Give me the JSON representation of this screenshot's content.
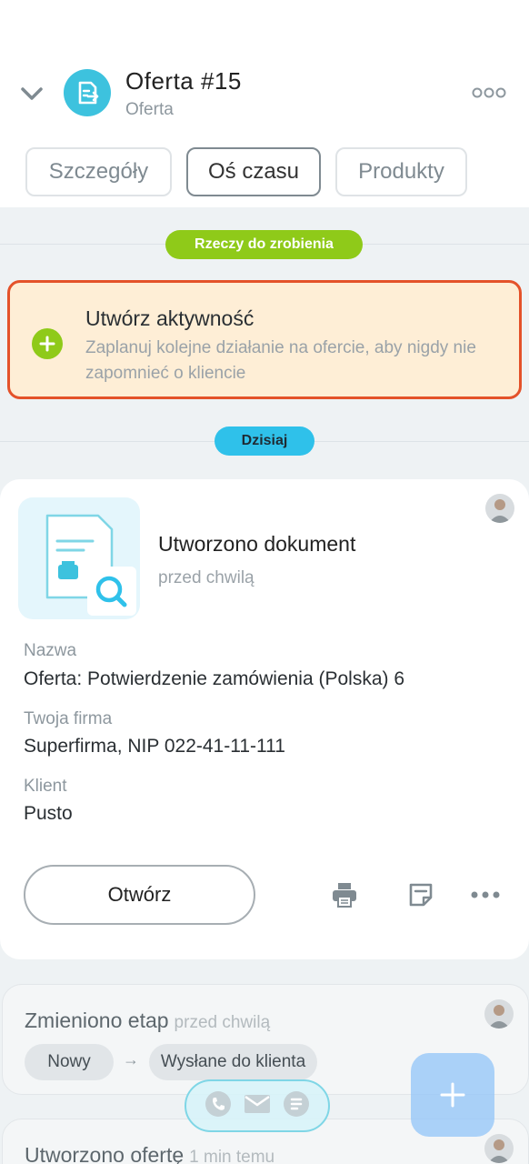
{
  "header": {
    "title": "Oferta #15",
    "subtitle": "Oferta"
  },
  "tabs": [
    {
      "label": "Szczegóły"
    },
    {
      "label": "Oś czasu"
    },
    {
      "label": "Produkty"
    }
  ],
  "todo_section": {
    "label": "Rzeczy do zrobienia",
    "color": "#8fca19",
    "card_title": "Utwórz aktywność",
    "card_desc": "Zaplanuj kolejne działanie na ofercie, aby nigdy nie zapomnieć o kliencie",
    "border_color": "#e4522a"
  },
  "today_section": {
    "label": "Dzisiaj",
    "color": "#2fc1ea"
  },
  "doc_card": {
    "title": "Utworzono dokument",
    "time": "przed chwilą",
    "fields": [
      {
        "label": "Nazwa",
        "value": "Oferta: Potwierdzenie zamówienia (Polska) 6"
      },
      {
        "label": "Twoja firma",
        "value": "Superfirma, NIP 022-41-11-111"
      },
      {
        "label": "Klient",
        "value": "Pusto"
      }
    ],
    "open_label": "Otwórz",
    "icons": [
      "print-icon",
      "note-icon",
      "more-icon"
    ]
  },
  "stage_card": {
    "title": "Zmieniono etap",
    "time": "przed chwilą",
    "from": "Nowy",
    "to": "Wysłane do klienta"
  },
  "created_card": {
    "title": "Utworzono ofertę",
    "time": "1 min temu"
  },
  "comm_icons": [
    "phone-icon",
    "mail-icon",
    "sms-icon"
  ],
  "fab_icon": "plus-icon"
}
